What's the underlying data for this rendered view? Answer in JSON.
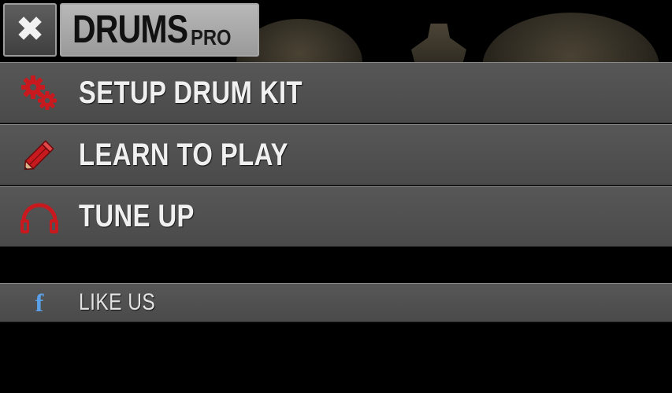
{
  "header": {
    "close_glyph": "✖",
    "title": "DRUMS",
    "title_suffix": "PRO"
  },
  "menu": {
    "items": [
      {
        "label": "SETUP DRUM KIT",
        "icon": "gears-icon"
      },
      {
        "label": "LEARN TO PLAY",
        "icon": "pencil-icon"
      },
      {
        "label": "TUNE UP",
        "icon": "headphones-icon"
      }
    ],
    "social": {
      "label": "LIKE US",
      "icon": "facebook-icon",
      "glyph": "f"
    }
  },
  "colors": {
    "icon_red": "#c8191e",
    "facebook_blue": "#5aa0e8",
    "row_bg": "#505050"
  }
}
